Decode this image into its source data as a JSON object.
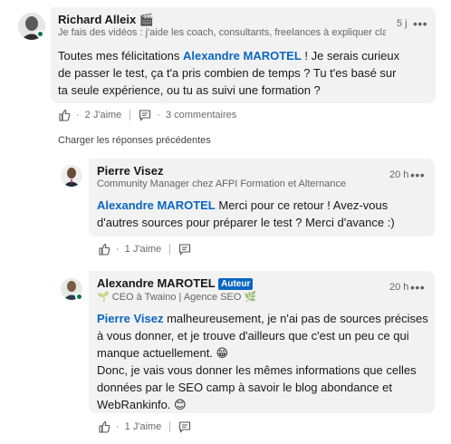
{
  "comment": {
    "author": "Richard Alleix",
    "author_emoji": "🎬",
    "headline": "Je fais des vidéos : j'aide les coach, consultants, freelances à expliquer clai...",
    "time": "5 j",
    "more": "•••",
    "text_parts": {
      "before": "Toutes mes félicitations ",
      "mention": "Alexandre MAROTEL",
      "after": " ! Je serais curieux de passer le test, ça t'a pris combien de temps ? Tu t'es basé sur ta seule expérience, ou tu as suivi une formation ?"
    },
    "likes": "2 J'aime",
    "comments": "3 commentaires",
    "separator": "·"
  },
  "load_previous": "Charger les réponses précédentes",
  "replies": [
    {
      "author": "Pierre Visez",
      "headline": "Community Manager chez AFPI Formation et Alternance",
      "time": "20 h",
      "more": "•••",
      "mention": "Alexandre MAROTEL",
      "text": " Merci pour ce retour ! Avez-vous d'autres sources pour préparer le test ? Merci d'avance :)",
      "likes": "1 J'aime",
      "separator": "·"
    },
    {
      "author": "Alexandre MAROTEL",
      "badge": "Auteur",
      "headline": "🌱 CEO à Twaino | Agence SEO 🌿",
      "time": "20 h",
      "more": "•••",
      "mention": "Pierre Visez",
      "text_line1": " malheureusement, je n'ai pas de sources précises à vous donner, et je trouve d'ailleurs que c'est un peu ce qui manque actuellement. 😁",
      "text_line2": "Donc, je vais vous donner les mêmes informations que celles données par le SEO camp à savoir le blog abondance et WebRankinfo. 😊",
      "likes": "1 J'aime",
      "separator": "·"
    }
  ],
  "colors": {
    "accent": "#0a66c2",
    "bubble": "#f2f2f2",
    "presence": "#057642"
  },
  "icons": [
    "like-icon",
    "comment-icon",
    "more-icon",
    "avatar"
  ]
}
